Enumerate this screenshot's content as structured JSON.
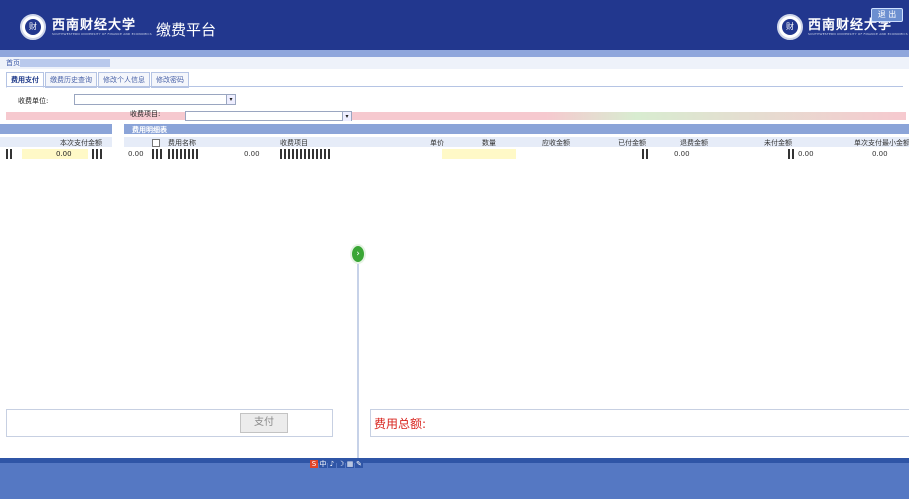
{
  "header": {
    "university_name": "西南财经大学",
    "platform_title": "缴费平台",
    "logout_label": "退 出",
    "logo_char": "财",
    "uni_sub": "SOUTHWESTERN UNIVERSITY OF FINANCE AND ECONOMICS"
  },
  "breadcrumb": {
    "label": "首页"
  },
  "tabs": [
    {
      "label": "费用支付"
    },
    {
      "label": "缴费历史查询"
    },
    {
      "label": "修改个人信息"
    },
    {
      "label": "修改密码"
    }
  ],
  "filters": {
    "unit_label": "收费单位:",
    "item_label": "收费项目:"
  },
  "left_panel": {
    "col_header": "本次支付金额",
    "row_value": "0.00"
  },
  "right_panel": {
    "title": "费用明细表",
    "columns": [
      "费用名称",
      "收费项目",
      "单价",
      "数量",
      "应收金额",
      "已付金额",
      "退费金额",
      "未付金额",
      "单次支付最小金额"
    ],
    "row": {
      "amount_a": "0.00",
      "amount_b": "0.00",
      "paid": "0.00",
      "unpaid": "0.00",
      "min_pay": "0.00"
    }
  },
  "payment": {
    "pay_button": "支付",
    "total_label": "费用总额:"
  },
  "tray": {
    "icons": [
      "S",
      "中",
      "♪",
      "☽",
      "▦",
      "✎"
    ]
  },
  "colors": {
    "header": "#22378e",
    "total_label": "#d8241e",
    "footer": "#5578c3"
  }
}
